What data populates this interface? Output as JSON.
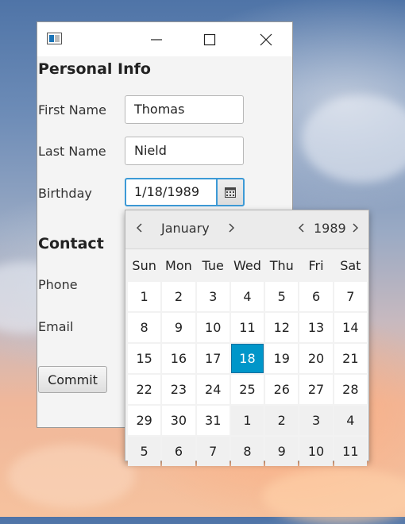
{
  "form": {
    "personal_title": "Personal Info",
    "first_name_label": "First Name",
    "first_name_value": "Thomas",
    "last_name_label": "Last Name",
    "last_name_value": "Nield",
    "birthday_label": "Birthday",
    "birthday_value": "1/18/1989",
    "contact_title": "Contact",
    "phone_label": "Phone",
    "email_label": "Email",
    "commit_label": "Commit"
  },
  "datepicker": {
    "month": "January",
    "year": "1989",
    "weekdays": [
      "Sun",
      "Mon",
      "Tue",
      "Wed",
      "Thu",
      "Fri",
      "Sat"
    ],
    "weeks": [
      [
        "1",
        "2",
        "3",
        "4",
        "5",
        "6",
        "7"
      ],
      [
        "8",
        "9",
        "10",
        "11",
        "12",
        "13",
        "14"
      ],
      [
        "15",
        "16",
        "17",
        "18",
        "19",
        "20",
        "21"
      ],
      [
        "22",
        "23",
        "24",
        "25",
        "26",
        "27",
        "28"
      ],
      [
        "29",
        "30",
        "31",
        "1",
        "2",
        "3",
        "4"
      ],
      [
        "5",
        "6",
        "7",
        "8",
        "9",
        "10",
        "11"
      ]
    ],
    "selected_day": "18",
    "accent_color": "#0096c9"
  },
  "icons": [
    "app-icon",
    "minimize-icon",
    "maximize-icon",
    "close-icon",
    "calendar-icon",
    "chevron-left-icon",
    "chevron-right-icon"
  ]
}
